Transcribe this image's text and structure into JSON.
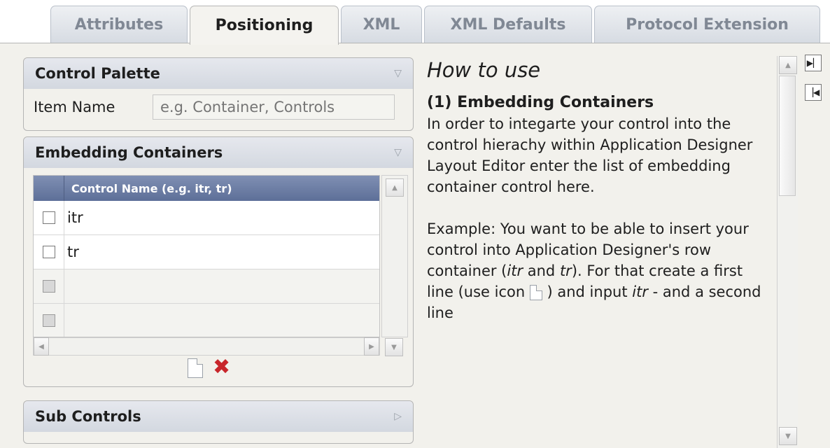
{
  "tabs": [
    {
      "label": "Attributes",
      "active": false
    },
    {
      "label": "Positioning",
      "active": true
    },
    {
      "label": "XML",
      "active": false
    },
    {
      "label": "XML Defaults",
      "active": false
    },
    {
      "label": "Protocol Extension",
      "active": false
    }
  ],
  "control_palette": {
    "title": "Control Palette",
    "item_name_label": "Item Name",
    "item_name_placeholder": "e.g. Container, Controls"
  },
  "embedding_containers": {
    "title": "Embedding Containers",
    "column_header": "Control Name (e.g. itr, tr)",
    "rows": [
      "itr",
      "tr",
      "",
      ""
    ]
  },
  "sub_controls": {
    "title": "Sub Controls"
  },
  "help": {
    "heading": "How to use",
    "section_title": "(1)  Embedding Containers",
    "para1": "In order to integarte your control into the control hierachy within Application Designer Layout Editor enter the list of embedding container control here.",
    "para2a": "Example: You want to be able to insert your control into Application Designer's row container (",
    "para2_itr": "itr",
    "para2_and": " and ",
    "para2_tr": "tr",
    "para2b": "). For that create a first line (use icon ",
    "para2c": " ) and input ",
    "para2_itr2": "itr",
    "para2d": " - and a second line"
  },
  "colors": {
    "accent": "#5d6f98",
    "delete": "#c8262b",
    "panel_bg": "#f2f1ec"
  }
}
